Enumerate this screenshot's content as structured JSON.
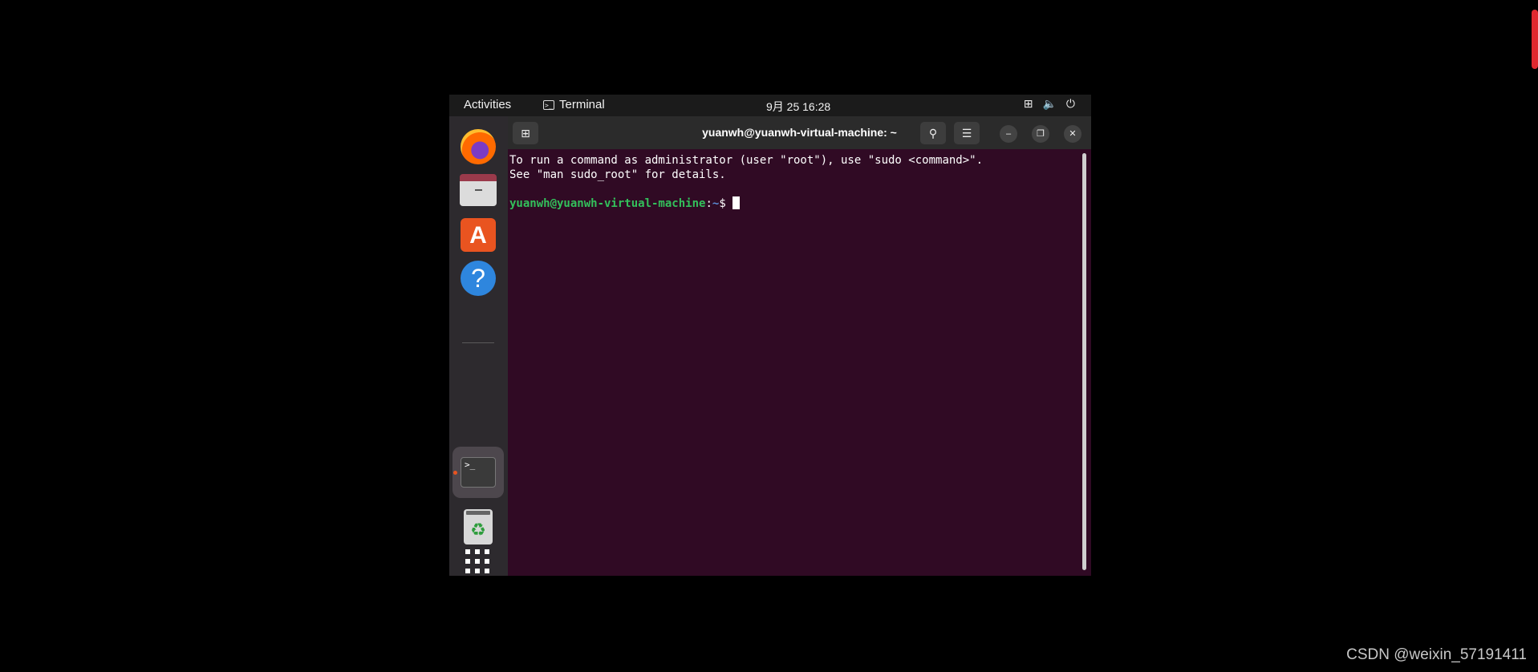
{
  "topbar": {
    "activities": "Activities",
    "app_name": "Terminal",
    "clock": "9月 25  16:28"
  },
  "terminal": {
    "title": "yuanwh@yuanwh-virtual-machine: ~",
    "lines": [
      "To run a command as administrator (user \"root\"), use \"sudo <command>\".",
      "See \"man sudo_root\" for details."
    ],
    "prompt_user": "yuanwh@yuanwh-virtual-machine",
    "prompt_sep": ":",
    "prompt_path": "~",
    "prompt_symbol": "$ "
  },
  "dock": {
    "items": [
      "firefox-icon",
      "files-icon",
      "app-store-icon",
      "help-icon",
      "terminal-icon",
      "trash-icon",
      "show-apps-icon"
    ]
  },
  "watermark": "CSDN @weixin_57191411",
  "colors": {
    "terminal_bg": "#300a24",
    "accent": "#e95420",
    "prompt_green": "#33c05b"
  }
}
